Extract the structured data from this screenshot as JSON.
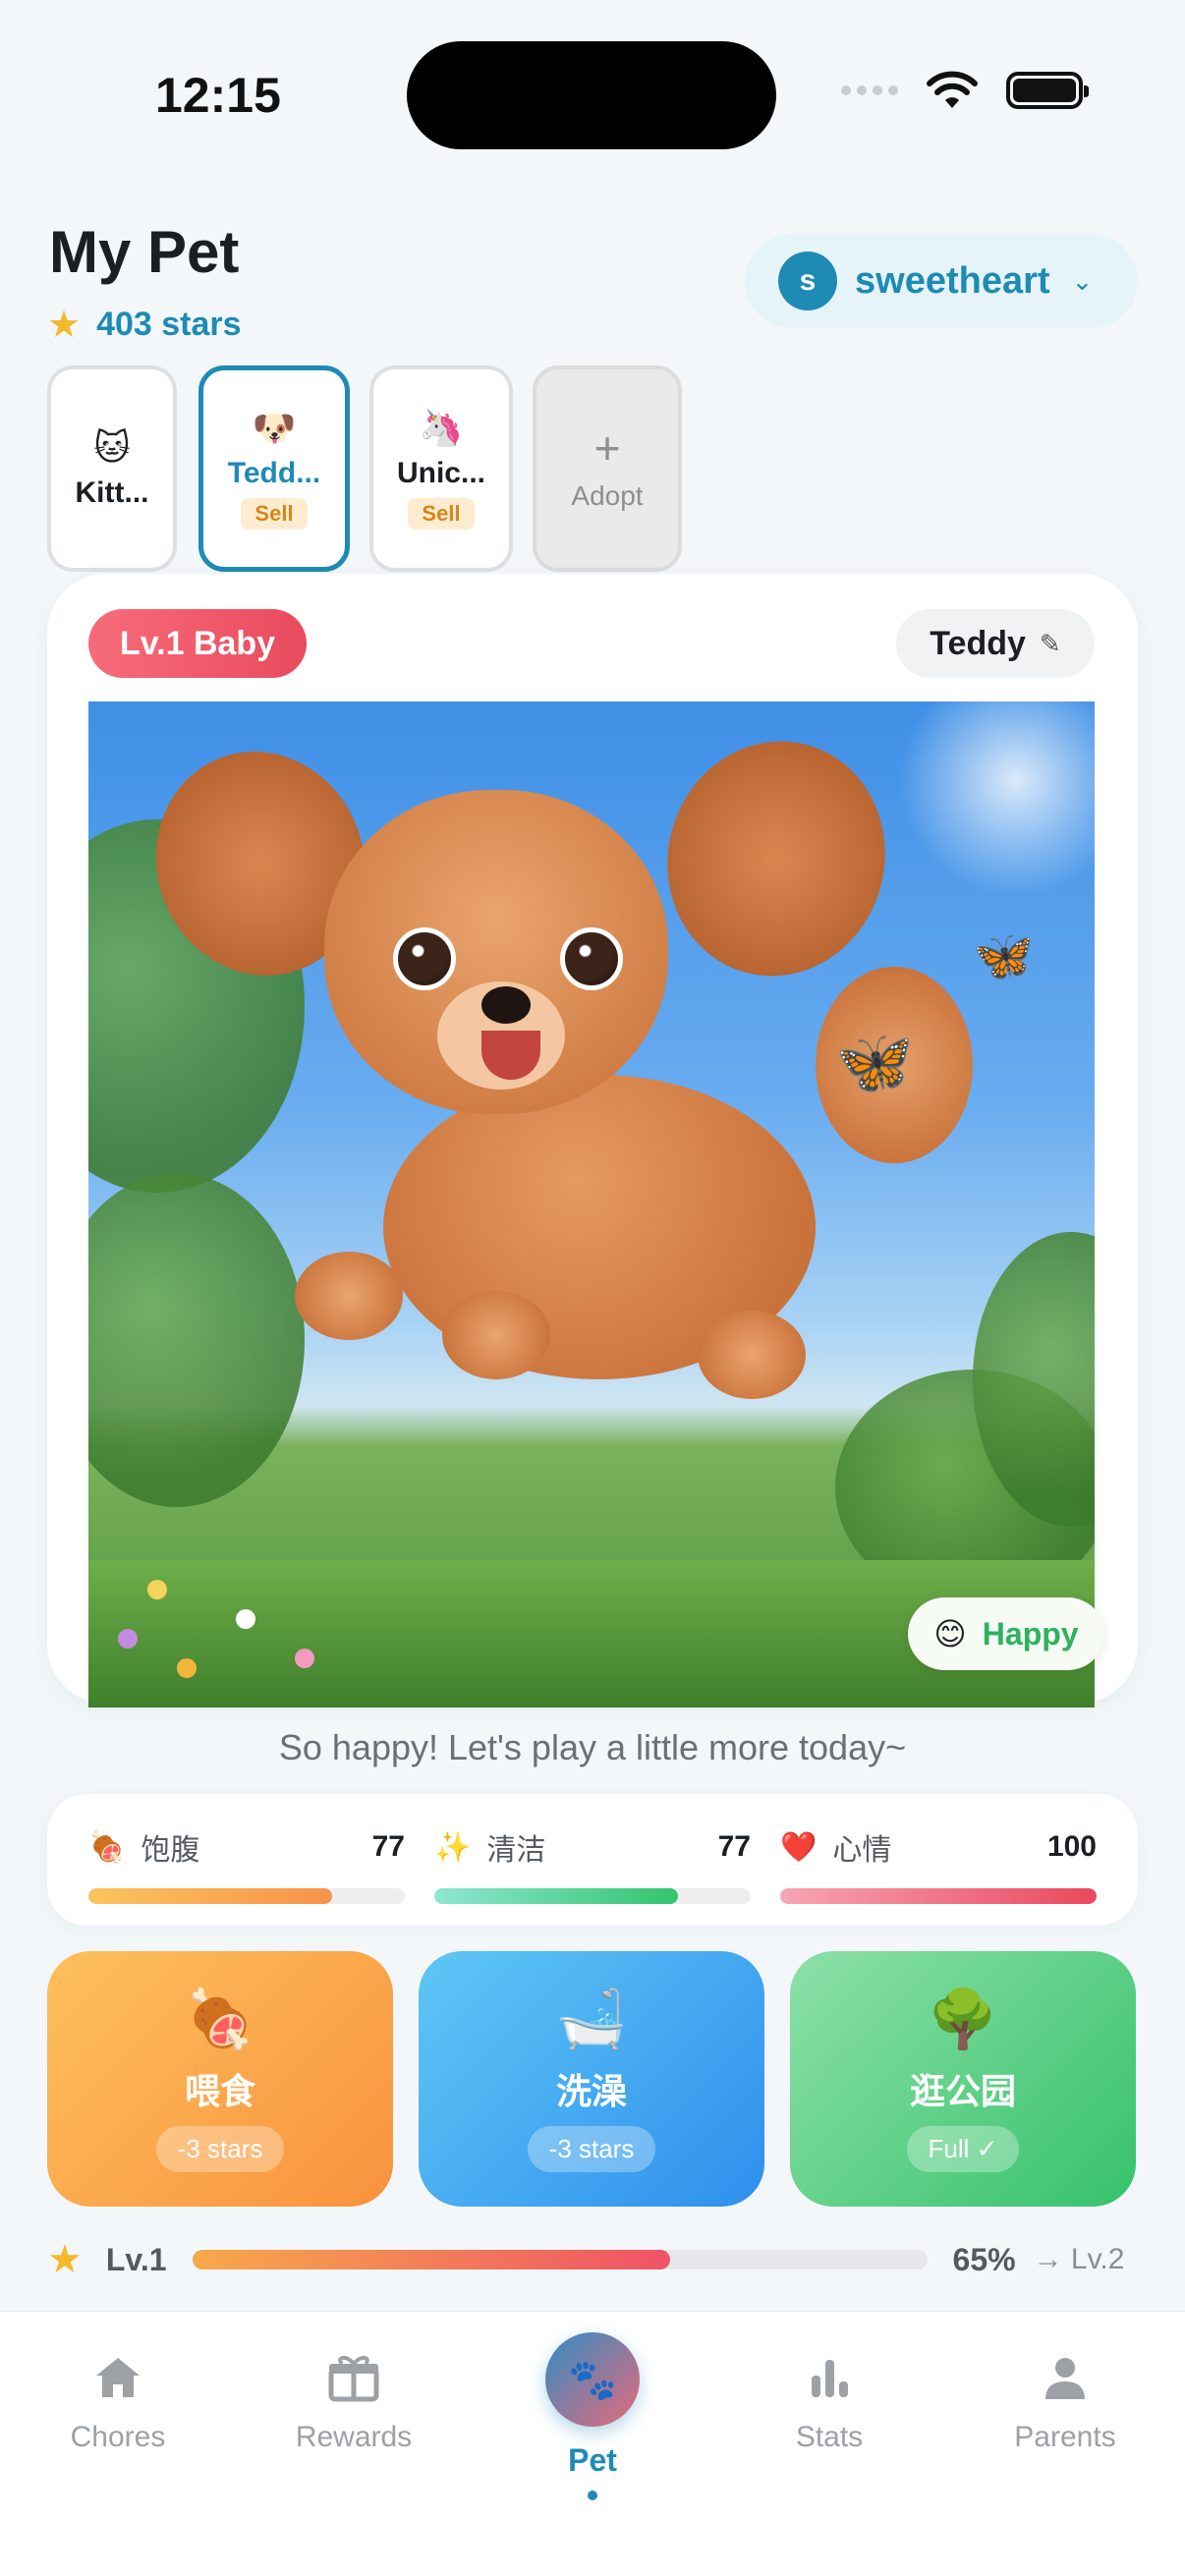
{
  "status_bar": {
    "time": "12:15"
  },
  "header": {
    "title": "My Pet",
    "stars_text": "403 stars",
    "user": {
      "initial": "s",
      "name": "sweetheart"
    }
  },
  "pet_tabs": [
    {
      "emoji": "🐱",
      "name": "Kitt...",
      "badge": ""
    },
    {
      "emoji": "🐶",
      "name": "Tedd...",
      "badge": "Sell",
      "active": true
    },
    {
      "emoji": "🦄",
      "name": "Unic...",
      "badge": "Sell"
    }
  ],
  "adopt": {
    "plus": "+",
    "label": "Adopt"
  },
  "pet_card": {
    "level_badge": "Lv.1 Baby",
    "pet_name": "Teddy",
    "mood_emoji": "😊",
    "mood": "Happy",
    "message": "So happy! Let's play a little more today~"
  },
  "stats": [
    {
      "icon": "🍖",
      "label": "饱腹",
      "value": "77",
      "fraction": 0.77,
      "color_from": "#fbc45e",
      "color_to": "#f7924a"
    },
    {
      "icon": "✨",
      "label": "清洁",
      "value": "77",
      "fraction": 0.77,
      "color_from": "#8ee6d4",
      "color_to": "#33c46d"
    },
    {
      "icon": "❤️",
      "label": "心情",
      "value": "100",
      "fraction": 1.0,
      "color_from": "#f7a5b5",
      "color_to": "#e9485c"
    }
  ],
  "actions": [
    {
      "icon": "🍖",
      "label": "喂食",
      "cost": "-3 stars"
    },
    {
      "icon": "🛁",
      "label": "洗澡",
      "cost": "-3 stars"
    },
    {
      "icon": "🌳",
      "label": "逛公园",
      "cost": "Full ✓"
    }
  ],
  "level": {
    "current": "Lv.1",
    "percent_text": "65%",
    "progress": 0.65,
    "next": "→ Lv.2"
  },
  "nav": {
    "chores": "Chores",
    "rewards": "Rewards",
    "pet": "Pet",
    "pet_icon": "🐾",
    "stats": "Stats",
    "parents": "Parents"
  },
  "colors": {
    "accent": "#1e8bb5",
    "happy_green": "#2db25e",
    "badge_red": "#e94a5e"
  }
}
